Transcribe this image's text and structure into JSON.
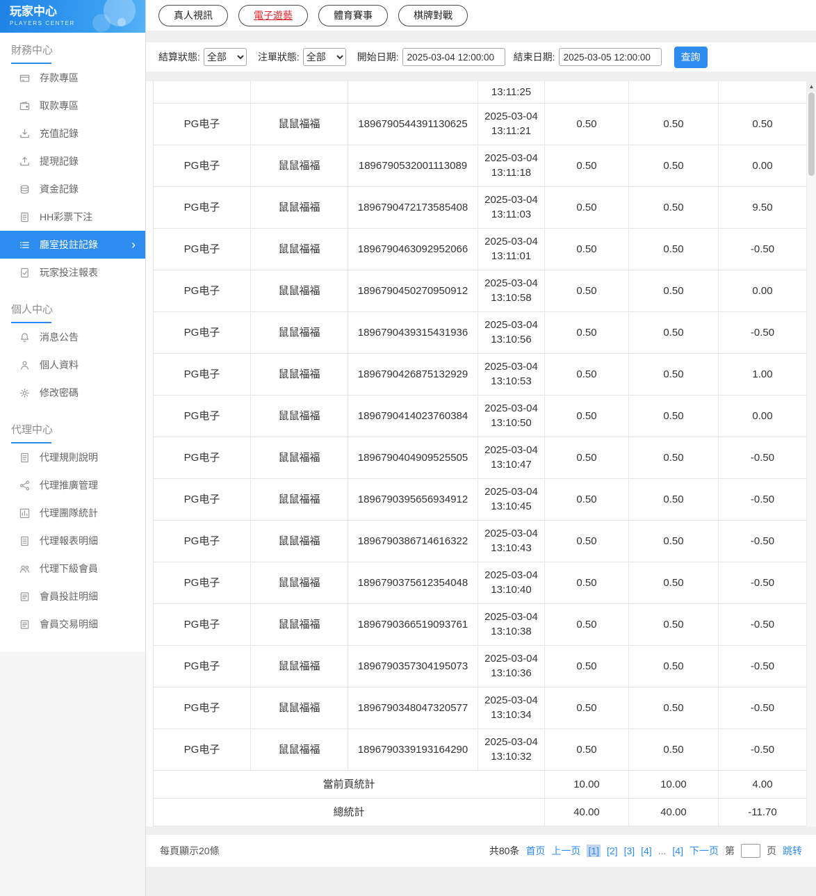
{
  "sidebar": {
    "title": "玩家中心",
    "subtitle": "PLAYERS CENTER",
    "sections": [
      {
        "title": "財務中心",
        "items": [
          {
            "label": "存款專區",
            "icon": "deposit-card-icon",
            "active": false
          },
          {
            "label": "取款專區",
            "icon": "withdraw-wallet-icon",
            "active": false
          },
          {
            "label": "充值記錄",
            "icon": "recharge-record-icon",
            "active": false
          },
          {
            "label": "提現記錄",
            "icon": "withdrawal-record-icon",
            "active": false
          },
          {
            "label": "資金記錄",
            "icon": "funds-record-icon",
            "active": false
          },
          {
            "label": "HH彩票下注",
            "icon": "lottery-bet-icon",
            "active": false
          },
          {
            "label": "廳室投註記錄",
            "icon": "room-bet-record-icon",
            "active": true
          },
          {
            "label": "玩家投注報表",
            "icon": "player-report-icon",
            "active": false
          }
        ]
      },
      {
        "title": "個人中心",
        "items": [
          {
            "label": "消息公告",
            "icon": "bell-icon",
            "active": false
          },
          {
            "label": "個人資料",
            "icon": "person-icon",
            "active": false
          },
          {
            "label": "修改密碼",
            "icon": "gear-icon",
            "active": false
          }
        ]
      },
      {
        "title": "代理中心",
        "items": [
          {
            "label": "代理規則說明",
            "icon": "doc-icon",
            "active": false
          },
          {
            "label": "代理推廣管理",
            "icon": "share-icon",
            "active": false
          },
          {
            "label": "代理團隊統計",
            "icon": "chart-icon",
            "active": false
          },
          {
            "label": "代理報表明細",
            "icon": "report-icon",
            "active": false
          },
          {
            "label": "代理下級會員",
            "icon": "people-icon",
            "active": false
          },
          {
            "label": "會員投註明細",
            "icon": "list-icon",
            "active": false
          },
          {
            "label": "會員交易明細",
            "icon": "list-icon",
            "active": false
          }
        ]
      }
    ]
  },
  "tabs": [
    {
      "label": "真人視訊",
      "active": false
    },
    {
      "label": "電子遊藝",
      "active": true
    },
    {
      "label": "體育賽事",
      "active": false
    },
    {
      "label": "棋牌對戰",
      "active": false
    }
  ],
  "filters": {
    "settle_status_label": "結算狀態:",
    "settle_status_value": "全部",
    "bet_status_label": "注單狀態:",
    "bet_status_value": "全部",
    "start_date_label": "開始日期:",
    "start_date_value": "2025-03-04 12:00:00",
    "end_date_label": "結束日期:",
    "end_date_value": "2025-03-05 12:00:00",
    "search_label": "查詢"
  },
  "table": {
    "partial_top_time": "13:11:25",
    "rows": [
      {
        "platform": "PG电子",
        "game": "鼠鼠福福",
        "order": "1896790544391130625",
        "date": "2025-03-04",
        "time": "13:11:21",
        "bet": "0.50",
        "valid": "0.50",
        "profit": "0.50"
      },
      {
        "platform": "PG电子",
        "game": "鼠鼠福福",
        "order": "1896790532001113089",
        "date": "2025-03-04",
        "time": "13:11:18",
        "bet": "0.50",
        "valid": "0.50",
        "profit": "0.00"
      },
      {
        "platform": "PG电子",
        "game": "鼠鼠福福",
        "order": "1896790472173585408",
        "date": "2025-03-04",
        "time": "13:11:03",
        "bet": "0.50",
        "valid": "0.50",
        "profit": "9.50"
      },
      {
        "platform": "PG电子",
        "game": "鼠鼠福福",
        "order": "1896790463092952066",
        "date": "2025-03-04",
        "time": "13:11:01",
        "bet": "0.50",
        "valid": "0.50",
        "profit": "-0.50"
      },
      {
        "platform": "PG电子",
        "game": "鼠鼠福福",
        "order": "1896790450270950912",
        "date": "2025-03-04",
        "time": "13:10:58",
        "bet": "0.50",
        "valid": "0.50",
        "profit": "0.00"
      },
      {
        "platform": "PG电子",
        "game": "鼠鼠福福",
        "order": "1896790439315431936",
        "date": "2025-03-04",
        "time": "13:10:56",
        "bet": "0.50",
        "valid": "0.50",
        "profit": "-0.50"
      },
      {
        "platform": "PG电子",
        "game": "鼠鼠福福",
        "order": "1896790426875132929",
        "date": "2025-03-04",
        "time": "13:10:53",
        "bet": "0.50",
        "valid": "0.50",
        "profit": "1.00"
      },
      {
        "platform": "PG电子",
        "game": "鼠鼠福福",
        "order": "1896790414023760384",
        "date": "2025-03-04",
        "time": "13:10:50",
        "bet": "0.50",
        "valid": "0.50",
        "profit": "0.00"
      },
      {
        "platform": "PG电子",
        "game": "鼠鼠福福",
        "order": "1896790404909525505",
        "date": "2025-03-04",
        "time": "13:10:47",
        "bet": "0.50",
        "valid": "0.50",
        "profit": "-0.50"
      },
      {
        "platform": "PG电子",
        "game": "鼠鼠福福",
        "order": "1896790395656934912",
        "date": "2025-03-04",
        "time": "13:10:45",
        "bet": "0.50",
        "valid": "0.50",
        "profit": "-0.50"
      },
      {
        "platform": "PG电子",
        "game": "鼠鼠福福",
        "order": "1896790386714616322",
        "date": "2025-03-04",
        "time": "13:10:43",
        "bet": "0.50",
        "valid": "0.50",
        "profit": "-0.50"
      },
      {
        "platform": "PG电子",
        "game": "鼠鼠福福",
        "order": "1896790375612354048",
        "date": "2025-03-04",
        "time": "13:10:40",
        "bet": "0.50",
        "valid": "0.50",
        "profit": "-0.50"
      },
      {
        "platform": "PG电子",
        "game": "鼠鼠福福",
        "order": "1896790366519093761",
        "date": "2025-03-04",
        "time": "13:10:38",
        "bet": "0.50",
        "valid": "0.50",
        "profit": "-0.50"
      },
      {
        "platform": "PG电子",
        "game": "鼠鼠福福",
        "order": "1896790357304195073",
        "date": "2025-03-04",
        "time": "13:10:36",
        "bet": "0.50",
        "valid": "0.50",
        "profit": "-0.50"
      },
      {
        "platform": "PG电子",
        "game": "鼠鼠福福",
        "order": "1896790348047320577",
        "date": "2025-03-04",
        "time": "13:10:34",
        "bet": "0.50",
        "valid": "0.50",
        "profit": "-0.50"
      },
      {
        "platform": "PG电子",
        "game": "鼠鼠福福",
        "order": "1896790339193164290",
        "date": "2025-03-04",
        "time": "13:10:32",
        "bet": "0.50",
        "valid": "0.50",
        "profit": "-0.50"
      }
    ],
    "page_total": {
      "label": "當前頁統計",
      "bet": "10.00",
      "valid": "10.00",
      "profit": "4.00"
    },
    "grand_total": {
      "label": "總統計",
      "bet": "40.00",
      "valid": "40.00",
      "profit": "-11.70"
    }
  },
  "pagination": {
    "page_size_text": "每頁顯示20條",
    "total_text": "共80条",
    "links": [
      {
        "label": "首页",
        "type": "nav",
        "current": false
      },
      {
        "label": "上一页",
        "type": "nav",
        "current": false
      },
      {
        "label": "[1]",
        "type": "page",
        "current": true
      },
      {
        "label": "[2]",
        "type": "page",
        "current": false
      },
      {
        "label": "[3]",
        "type": "page",
        "current": false
      },
      {
        "label": "[4]",
        "type": "page",
        "current": false
      },
      {
        "label": "...",
        "type": "ellipsis",
        "current": false
      },
      {
        "label": "[4]",
        "type": "page",
        "current": false
      },
      {
        "label": "下一页",
        "type": "nav",
        "current": false
      }
    ],
    "jump_prefix": "第",
    "jump_suffix": "页",
    "jump_action": "跳转"
  }
}
